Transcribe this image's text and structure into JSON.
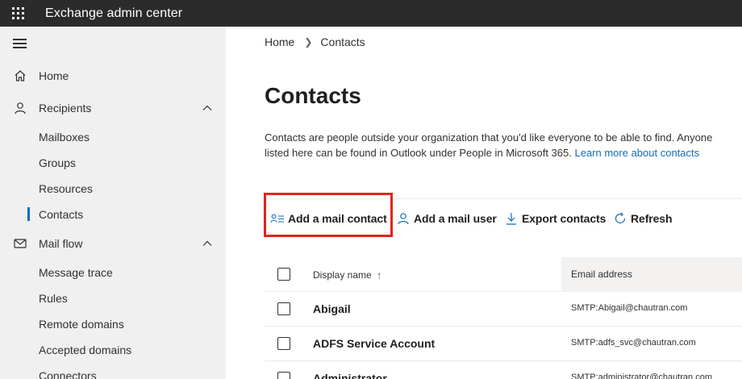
{
  "app": {
    "title": "Exchange admin center"
  },
  "sidebar": {
    "items": [
      {
        "label": "Home",
        "icon": "home-icon"
      },
      {
        "label": "Recipients",
        "icon": "person-icon",
        "expanded": true
      },
      {
        "label": "Mailboxes"
      },
      {
        "label": "Groups"
      },
      {
        "label": "Resources"
      },
      {
        "label": "Contacts",
        "active": true
      },
      {
        "label": "Mail flow",
        "icon": "mail-icon",
        "expanded": true
      },
      {
        "label": "Message trace"
      },
      {
        "label": "Rules"
      },
      {
        "label": "Remote domains"
      },
      {
        "label": "Accepted domains"
      },
      {
        "label": "Connectors"
      }
    ]
  },
  "breadcrumb": {
    "home": "Home",
    "current": "Contacts"
  },
  "page": {
    "title": "Contacts",
    "description_line1": "Contacts are people outside your organization that you'd like everyone to be able to find. Anyone",
    "description_line2": "listed here can be found in Outlook under People in Microsoft 365.",
    "learn_more": "Learn more about contacts"
  },
  "toolbar": {
    "add_mail_contact": "Add a mail contact",
    "add_mail_user": "Add a mail user",
    "export_contacts": "Export contacts",
    "refresh": "Refresh"
  },
  "table": {
    "columns": [
      "Display name",
      "Email address"
    ],
    "sort_arrow": "↑",
    "rows": [
      {
        "name": "Abigail",
        "email": "SMTP:Abigail@chautran.com"
      },
      {
        "name": "ADFS Service Account",
        "email": "SMTP:adfs_svc@chautran.com"
      },
      {
        "name": "Administrator",
        "email": "SMTP:administrator@chautran.com"
      }
    ]
  },
  "colors": {
    "topbar": "#2b2b2b",
    "sidebar": "#f0f0f0",
    "accent": "#0f6cbd",
    "highlight": "#e1241a"
  }
}
